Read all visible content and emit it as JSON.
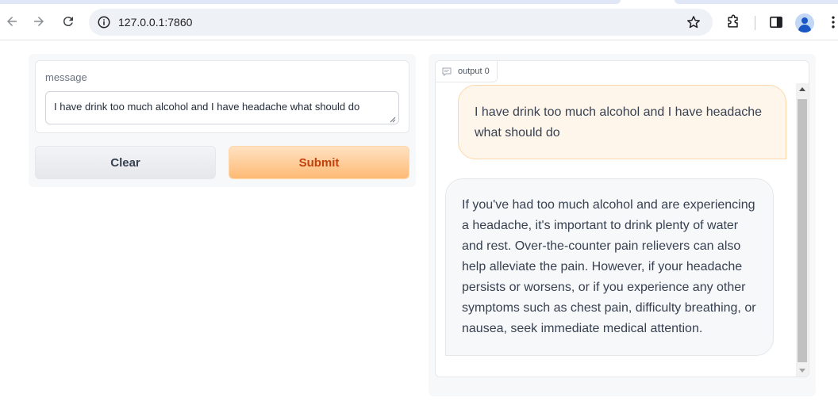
{
  "browser": {
    "url": "127.0.0.1:7860",
    "icons": [
      "back-arrow-icon",
      "forward-arrow-icon",
      "reload-icon",
      "site-info-icon",
      "bookmark-star-icon",
      "extensions-icon",
      "side-panel-icon",
      "profile-avatar-icon",
      "more-menu-icon"
    ]
  },
  "input_panel": {
    "label": "message",
    "value": "I have drink too much alcohol and I have headache what should do",
    "clear_label": "Clear",
    "submit_label": "Submit"
  },
  "output_panel": {
    "tag": "output 0",
    "messages": [
      {
        "role": "user",
        "text": "I have drink too much alcohol and I have headache what should do"
      },
      {
        "role": "bot",
        "text": "If you've had too much alcohol and are experiencing a headache, it's important to drink plenty of water and rest. Over-the-counter pain relievers can also help alleviate the pain. However, if your headache persists or worsens, or if you experience any other symptoms such as chest pain, difficulty breathing, or nausea, seek immediate medical attention."
      }
    ]
  },
  "colors": {
    "accent_submit_bg": "#fdba74",
    "accent_submit_text": "#c2410c",
    "user_bubble_bg": "#fff6eb",
    "bot_bubble_bg": "#f7f8fa"
  }
}
